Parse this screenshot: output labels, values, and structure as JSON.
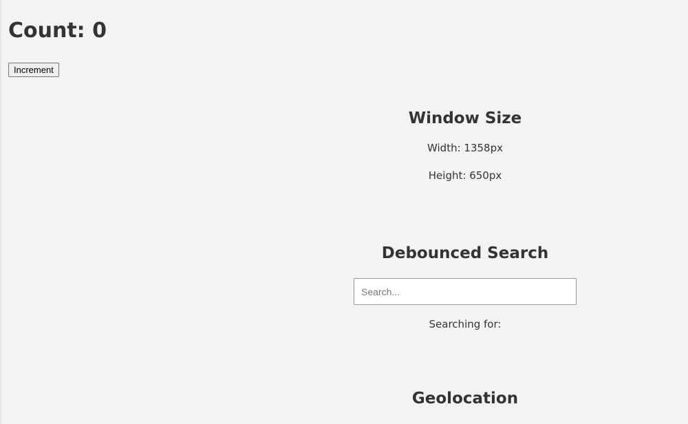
{
  "counter": {
    "title": "Count: 0",
    "button_label": "Increment"
  },
  "window_size": {
    "title": "Window Size",
    "width_text": "Width: 1358px",
    "height_text": "Height: 650px"
  },
  "debounced_search": {
    "title": "Debounced Search",
    "input_value": "",
    "input_placeholder": "Search...",
    "searching_text": "Searching for:"
  },
  "geolocation": {
    "title": "Geolocation"
  },
  "colors": {
    "background": "#f3f3f3",
    "text": "#333333",
    "input_border": "#9a9a9a"
  }
}
